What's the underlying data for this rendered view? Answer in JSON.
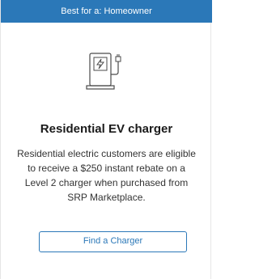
{
  "card": {
    "banner_text": "Best for a: Homeowner",
    "icon": "ev-charger-icon",
    "title": "Residential EV charger",
    "description": "Residential electric customers are eligible to receive a $250 instant rebate on a Level 2 charger when purchased from SRP Marketplace.",
    "button_label": "Find a Charger"
  },
  "colors": {
    "accent": "#2b78b8",
    "text": "#1a1a1a",
    "body_text": "#333333",
    "icon_stroke": "#4a4a4a",
    "background": "#ffffff"
  }
}
